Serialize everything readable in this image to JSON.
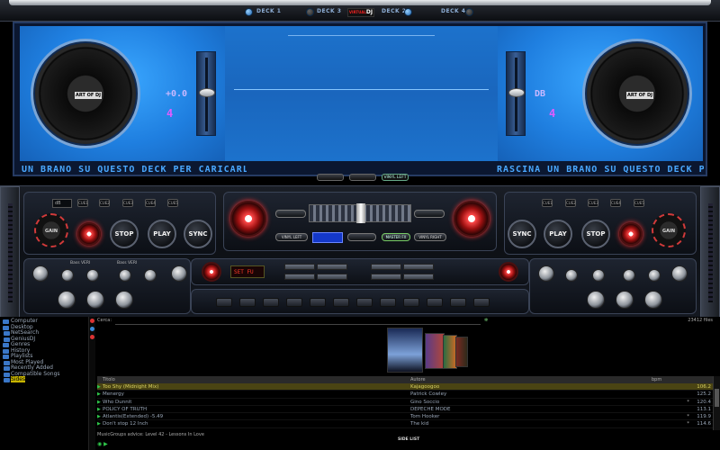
{
  "top_bar": {
    "deck1": "DECK 1",
    "deck3": "DECK 3",
    "deck2": "DECK 2",
    "deck4": "DECK 4",
    "logo_a": "VIRTUAL",
    "logo_b": "DJ"
  },
  "screen": {
    "left_pitch": "+0.0",
    "left_key": "4",
    "right_pitch": "DB",
    "right_key": "4",
    "left_ticker": "UN BRANO SU QUESTO DECK PER CARICARL",
    "right_ticker": "RASCINA UN BRANO SU QUESTO DECK PER CI",
    "platter_label": "ART OF DJ",
    "vinyl_button": "VINYL LEFT"
  },
  "mixer": {
    "left": {
      "db": "dB",
      "cues": [
        "CUE1",
        "CUE2",
        "CUE3",
        "CUE4",
        "CUE5"
      ],
      "gain": "GAIN",
      "stop": "STOP",
      "play": "PLAY",
      "sync": "SYNC",
      "eq_label_1": "Bass VERI",
      "eq_label_2": "Bass VERI"
    },
    "right": {
      "cues": [
        "CUE1",
        "CUE2",
        "CUE3",
        "CUE4",
        "CUE5"
      ],
      "gain": "GAIN",
      "stop": "STOP",
      "play": "PLAY",
      "sync": "SYNC"
    },
    "center": {
      "vinyl_left": "VINYL LEFT",
      "master": "MASTER FX",
      "vinyl_right": "VINYL RIGHT",
      "fx_display": "SET FU",
      "crossfader": 0.5
    }
  },
  "browser": {
    "tree": [
      {
        "label": "Computer",
        "level": 0
      },
      {
        "label": "Desktop",
        "level": 0
      },
      {
        "label": "NetSearch",
        "level": 1
      },
      {
        "label": "GeniusDJ",
        "level": 1
      },
      {
        "label": "Genres",
        "level": 0
      },
      {
        "label": "History",
        "level": 0
      },
      {
        "label": "Playlists",
        "level": 0
      },
      {
        "label": "Most Played",
        "level": 1
      },
      {
        "label": "Recently Added",
        "level": 1
      },
      {
        "label": "Compatible Songs",
        "level": 1
      },
      {
        "label": "Sides",
        "level": 1
      }
    ],
    "search_label": "Cerca:",
    "search_value": "",
    "file_count": "23412 files",
    "columns": {
      "title": "Titolo",
      "artist": "Autore",
      "bpm": "bpm"
    },
    "tracks": [
      {
        "title": "Too Shy (Midnight Mix)",
        "artist": "Kajagoogoo",
        "bpm": "106.2",
        "star": "",
        "selected": true
      },
      {
        "title": "Menergy",
        "artist": "Patrick Cowley",
        "bpm": "125.2",
        "star": "",
        "selected": false
      },
      {
        "title": "Who Dunnit",
        "artist": "Gino Soccio",
        "bpm": "120.4",
        "star": "*",
        "selected": false
      },
      {
        "title": "POLICY OF TRUTH",
        "artist": "DEPECHE MODE",
        "bpm": "113.1",
        "star": "",
        "selected": false
      },
      {
        "title": "Atlantis(Extended) -5.49",
        "artist": "Tom Hooker",
        "bpm": "119.9",
        "star": "*",
        "selected": false
      },
      {
        "title": "Don't stop 12 Inch",
        "artist": "The kid",
        "bpm": "114.6",
        "star": "*",
        "selected": false
      }
    ],
    "advice": "MusicGroups advice: Level 42 - Lessons In Love",
    "side_list": "SIDE LIST"
  }
}
